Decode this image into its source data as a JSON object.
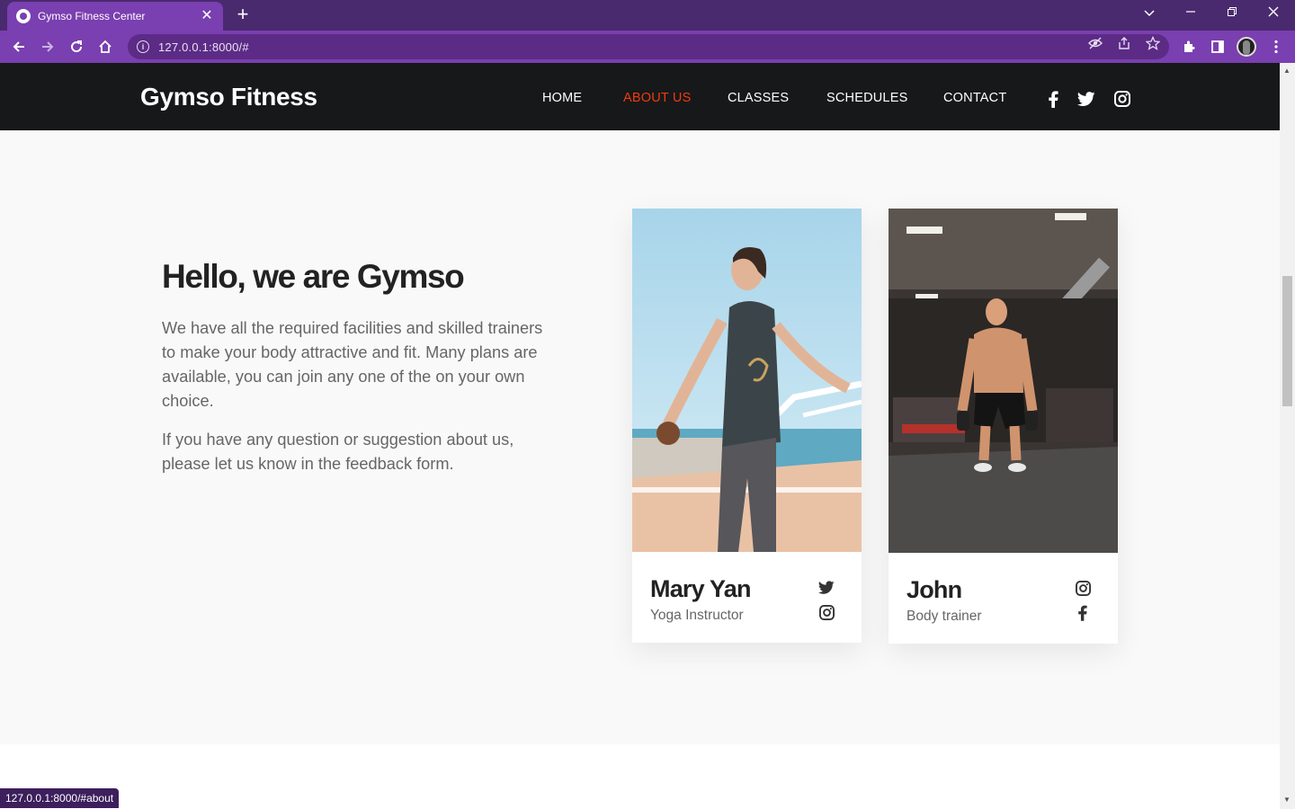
{
  "browser": {
    "tab_title": "Gymso Fitness Center",
    "tab_close": "✕",
    "new_tab": "+",
    "url": "127.0.0.1:8000/#",
    "status_url": "127.0.0.1:8000/#about"
  },
  "site": {
    "brand": "Gymso Fitness",
    "nav": {
      "home": "HOME",
      "about": "ABOUT US",
      "classes": "CLASSES",
      "schedules": "SCHEDULES",
      "contact": "CONTACT"
    },
    "about": {
      "title": "Hello, we are Gymso",
      "p1": "We have all the required facilities and skilled trainers to make your body attractive and fit. Many plans are available, you can join any one of the on your own choice.",
      "p2": "If you have any question or suggestion about us, please let us know in the feedback form."
    },
    "trainers": [
      {
        "name": "Mary Yan",
        "role": "Yoga Instructor",
        "icons": [
          "twitter-icon",
          "instagram-icon"
        ]
      },
      {
        "name": "John",
        "role": "Body trainer",
        "icons": [
          "instagram-icon",
          "facebook-icon"
        ]
      }
    ]
  },
  "colors": {
    "accent": "#f13a11",
    "navbar": "#171819",
    "browser_frame": "#7a3fb0"
  }
}
